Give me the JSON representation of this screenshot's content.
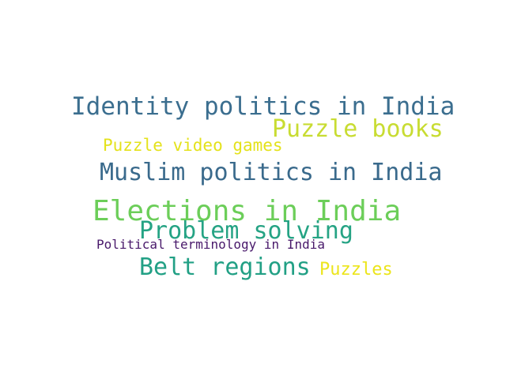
{
  "word_cloud": {
    "words": [
      {
        "id": "identity",
        "text": "Identity politics in India",
        "color": "#3b6e8f"
      },
      {
        "id": "pbooks",
        "text": "Puzzle books",
        "color": "#c8dc32"
      },
      {
        "id": "pvideo",
        "text": "Puzzle video games",
        "color": "#e4e21b"
      },
      {
        "id": "muslim",
        "text": "Muslim politics in India",
        "color": "#3a6a8c"
      },
      {
        "id": "elections",
        "text": "Elections in India",
        "color": "#6cce59"
      },
      {
        "id": "problem",
        "text": "Problem solving",
        "color": "#25a384"
      },
      {
        "id": "polterm",
        "text": "Political terminology in India",
        "color": "#48186a"
      },
      {
        "id": "belt",
        "text": "Belt regions",
        "color": "#22a085"
      },
      {
        "id": "puzzles",
        "text": "Puzzles",
        "color": "#ece51b"
      }
    ]
  }
}
